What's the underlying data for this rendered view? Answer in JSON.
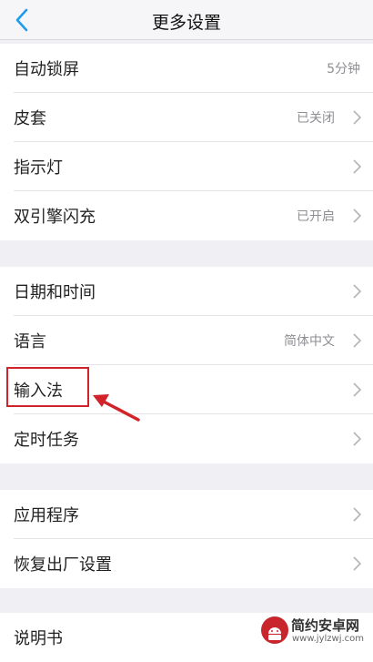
{
  "header": {
    "title": "更多设置",
    "back_icon": "chevron-left-icon",
    "accent": "#1e9bf0"
  },
  "group1": {
    "items": [
      {
        "label": "自动锁屏",
        "value": "5分钟"
      },
      {
        "label": "皮套",
        "value": "已关闭"
      },
      {
        "label": "指示灯",
        "value": ""
      },
      {
        "label": "双引擎闪充",
        "value": "已开启"
      }
    ]
  },
  "group2": {
    "items": [
      {
        "label": "日期和时间",
        "value": ""
      },
      {
        "label": "语言",
        "value": "简体中文"
      },
      {
        "label": "输入法",
        "value": ""
      },
      {
        "label": "定时任务",
        "value": ""
      }
    ]
  },
  "group3": {
    "items": [
      {
        "label": "应用程序",
        "value": ""
      },
      {
        "label": "恢复出厂设置",
        "value": ""
      }
    ]
  },
  "group4": {
    "items": [
      {
        "label": "说明书",
        "value": ""
      }
    ]
  },
  "annotation": {
    "color": "#d2232a"
  },
  "watermark": {
    "name": "简约安卓网",
    "url": "www.jylzwj.com",
    "icon": "android-logo-icon"
  }
}
